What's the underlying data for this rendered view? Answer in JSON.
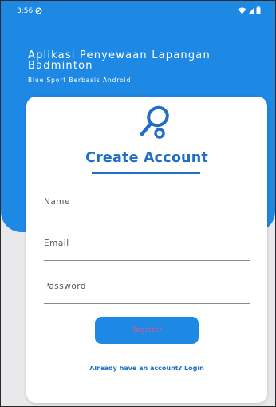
{
  "status_bar": {
    "time": "3:56",
    "icons": [
      "do-not-disturb-icon",
      "wifi-icon",
      "signal-icon",
      "battery-icon"
    ]
  },
  "header": {
    "title": "Aplikasi Penyewaan Lapangan Badminton",
    "subtitle": "Blue Sport Berbasis Android"
  },
  "form": {
    "logo_icon": "badminton-racket-icon",
    "title": "Create Account",
    "name_label": "Name",
    "email_label": "Email",
    "password_label": "Password",
    "register_label": "Register",
    "login_link": "Already have an account? Login"
  },
  "colors": {
    "primary": "#1e88e5",
    "title_blue": "#1e6fc5",
    "register_text": "#e25a8a"
  }
}
